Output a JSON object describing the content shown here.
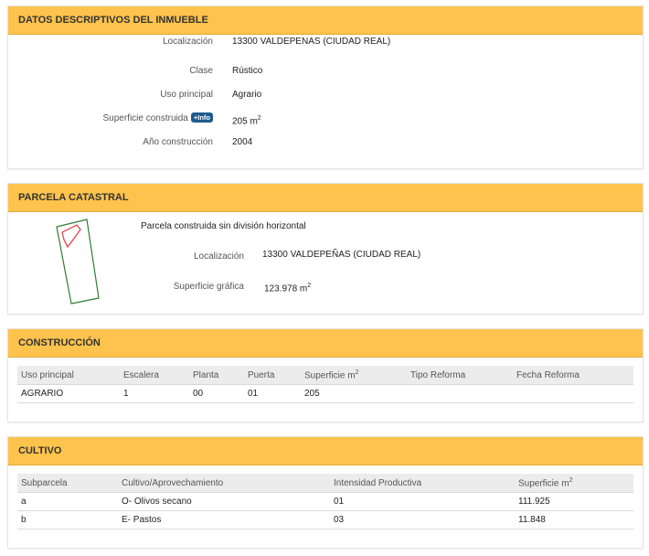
{
  "inmueble": {
    "title": "DATOS DESCRIPTIVOS DEL INMUEBLE",
    "localizacion_label": "Localización",
    "localizacion_value": "13300 VALDEPENAS (CIUDAD REAL)",
    "clase_label": "Clase",
    "clase_value": "Rústico",
    "uso_label": "Uso principal",
    "uso_value": "Agrario",
    "superficie_label": "Superficie construida",
    "info_badge": "+Info",
    "superficie_value": "205 m",
    "superficie_unit_sup": "2",
    "anio_label": "Año construcción",
    "anio_value": "2004"
  },
  "parcela": {
    "title": "PARCELA CATASTRAL",
    "descripcion": "Parcela construida sin división horizontal",
    "localizacion_label": "Localización",
    "localizacion_value": "13300 VALDEPEÑAS (CIUDAD REAL)",
    "superficie_label": "Superficie gráfica",
    "superficie_value": "123.978 m",
    "superficie_unit_sup": "2"
  },
  "construccion": {
    "title": "CONSTRUCCIÓN",
    "headers": [
      "Uso principal",
      "Escalera",
      "Planta",
      "Puerta",
      "Superficie m",
      "Tipo Reforma",
      "Fecha Reforma"
    ],
    "superficie_header_sup": "2",
    "rows": [
      [
        "AGRARIO",
        "1",
        "00",
        "01",
        "205",
        "",
        ""
      ]
    ]
  },
  "cultivo": {
    "title": "CULTIVO",
    "headers": [
      "Subparcela",
      "Cultivo/Aprovechamiento",
      "Intensidad Productiva",
      "Superficie m"
    ],
    "superficie_header_sup": "2",
    "rows": [
      [
        "a",
        "O- Olivos secano",
        "01",
        "111.925"
      ],
      [
        "b",
        "E- Pastos",
        "03",
        "11.848"
      ]
    ]
  },
  "colors": {
    "header_bg": "#fdc34c",
    "info_badge_bg": "#1f5b8c",
    "parcel_outline": "#2e7d32",
    "parcel_building": "#e53935"
  }
}
